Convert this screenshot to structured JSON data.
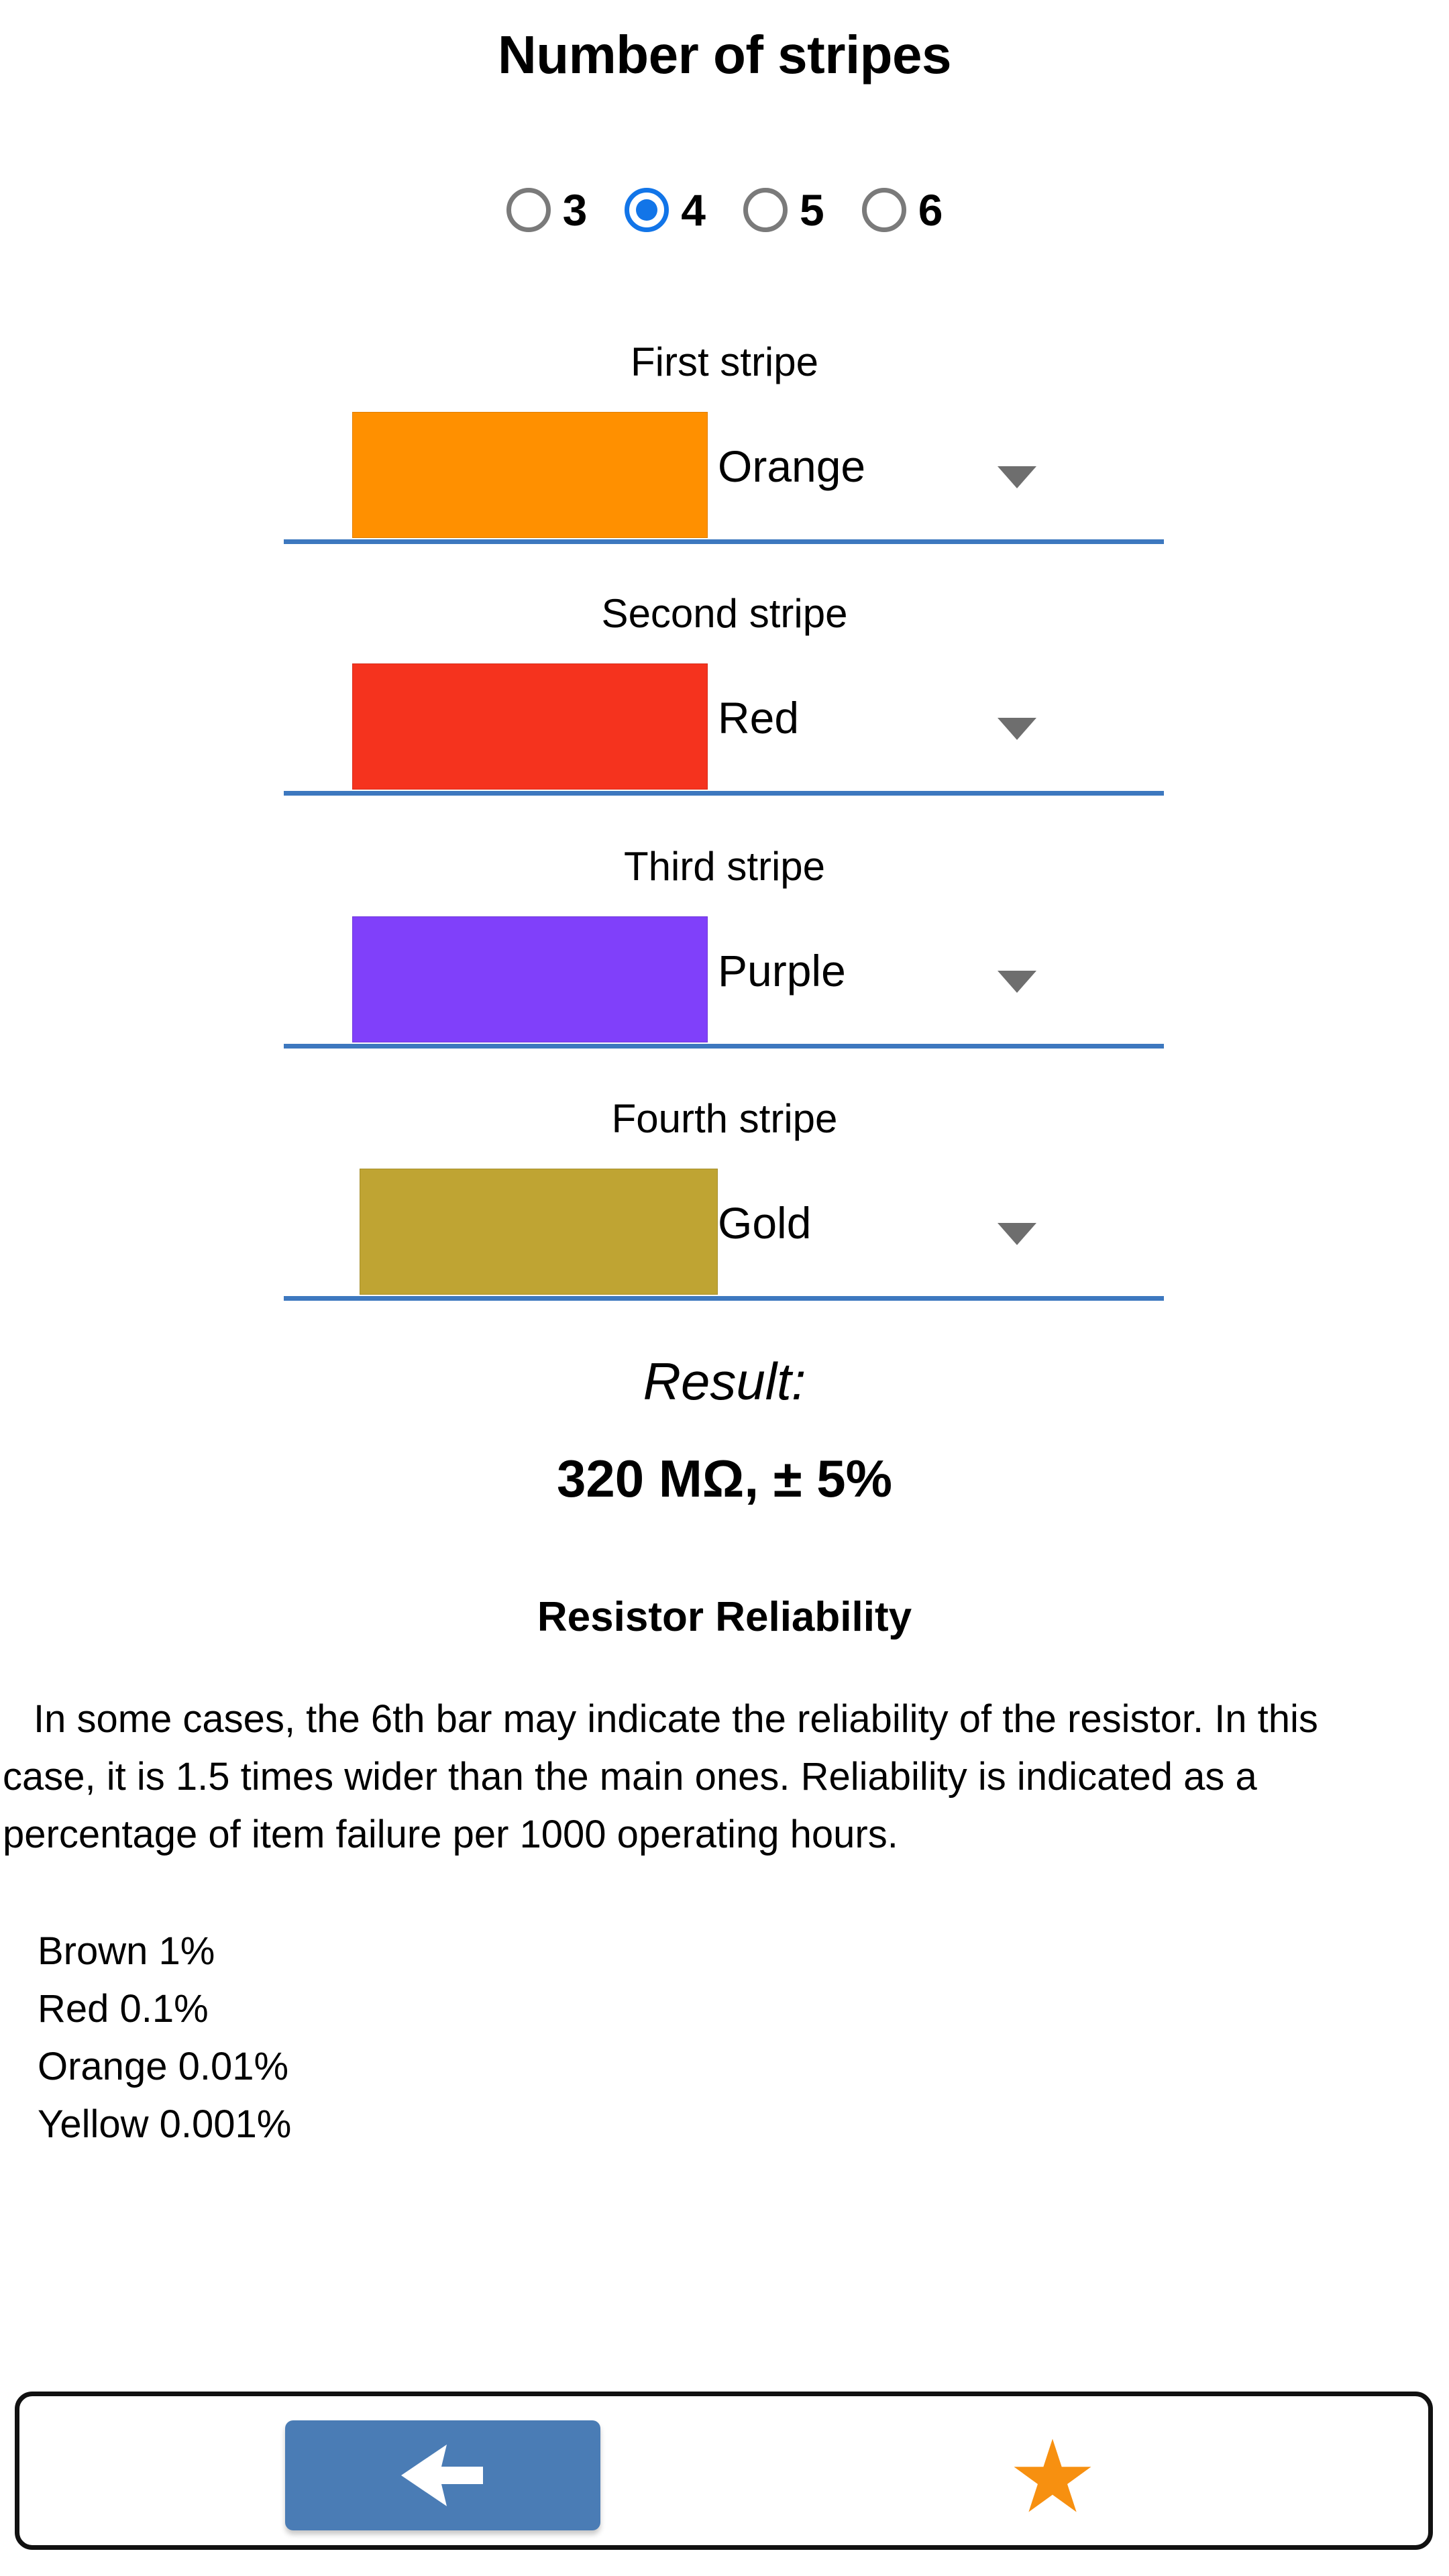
{
  "app": {
    "title": "Number of stripes"
  },
  "stripe_count": {
    "options": [
      "3",
      "4",
      "5",
      "6"
    ],
    "selected": "4",
    "accent_color": "#1275E8",
    "unselected_color": "#7a7a7a"
  },
  "stripes": [
    {
      "caption": "First stripe",
      "value": "Orange",
      "color": "#FF9000",
      "wide": false,
      "dropdown_icon": "chevron-down-icon"
    },
    {
      "caption": "Second stripe",
      "value": "Red",
      "color": "#F5331E",
      "wide": false,
      "dropdown_icon": "chevron-down-icon"
    },
    {
      "caption": "Third stripe",
      "value": "Purple",
      "color": "#8040FA",
      "wide": false,
      "dropdown_icon": "chevron-down-icon"
    },
    {
      "caption": "Fourth stripe",
      "value": "Gold",
      "color": "#BFA433",
      "wide": true,
      "dropdown_icon": "chevron-down-icon"
    }
  ],
  "result": {
    "label": "Result:",
    "value": "320 MΩ, ± 5%"
  },
  "reliability": {
    "title": "Resistor Reliability",
    "paragraph": "In some cases, the 6th bar may indicate the reliability of the resistor. In this case, it is 1.5 times wider than the main ones. Reliability is indicated as a percentage of item failure per 1000 operating hours.",
    "items": [
      "Brown 1%",
      "Red 0.1%",
      "Orange 0.01%",
      "Yellow 0.001%"
    ]
  },
  "bottom_bar": {
    "back_icon": "arrow-left-icon",
    "back_color": "#4a7cb5",
    "favorite_icon": "star-icon",
    "favorite_glyph": "★",
    "favorite_color": "#F79010"
  }
}
